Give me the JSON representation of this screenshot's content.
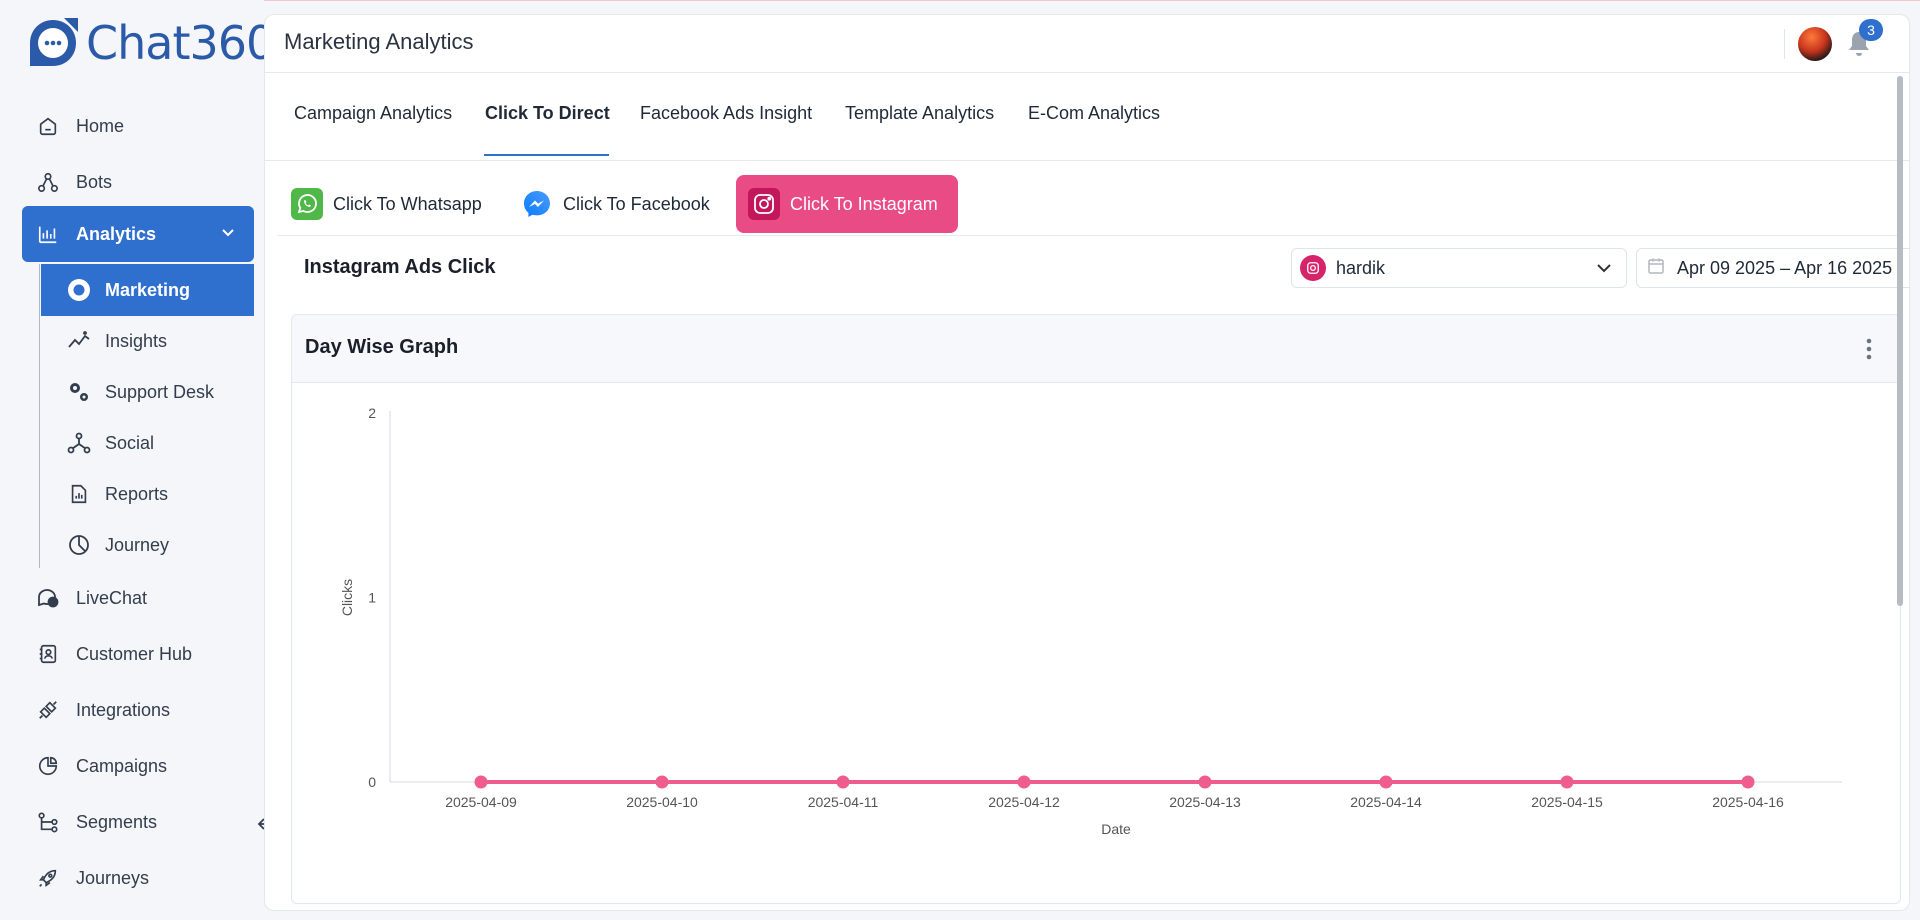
{
  "app": {
    "logo_text": "Chat360"
  },
  "sidebar": {
    "items": [
      {
        "label": "Home",
        "icon": "home-icon"
      },
      {
        "label": "Bots",
        "icon": "bots-icon"
      },
      {
        "label": "Analytics",
        "icon": "analytics-icon",
        "active": true
      },
      {
        "label": "LiveChat",
        "icon": "livechat-icon"
      },
      {
        "label": "Customer Hub",
        "icon": "customer-hub-icon"
      },
      {
        "label": "Integrations",
        "icon": "integrations-icon"
      },
      {
        "label": "Campaigns",
        "icon": "campaigns-icon"
      },
      {
        "label": "Segments",
        "icon": "segments-icon"
      },
      {
        "label": "Journeys",
        "icon": "journeys-icon"
      }
    ],
    "analytics_sub": [
      {
        "label": "Marketing",
        "icon": "marketing-icon",
        "active": true
      },
      {
        "label": "Insights",
        "icon": "insights-icon"
      },
      {
        "label": "Support Desk",
        "icon": "support-desk-icon"
      },
      {
        "label": "Social",
        "icon": "social-icon"
      },
      {
        "label": "Reports",
        "icon": "reports-icon"
      },
      {
        "label": "Journey",
        "icon": "journey-icon"
      }
    ]
  },
  "header": {
    "title": "Marketing Analytics",
    "notification_count": "3"
  },
  "tabs": [
    {
      "label": "Campaign Analytics"
    },
    {
      "label": "Click To Direct",
      "active": true
    },
    {
      "label": "Facebook Ads Insight"
    },
    {
      "label": "Template Analytics"
    },
    {
      "label": "E-Com Analytics"
    }
  ],
  "subtabs": [
    {
      "label": "Click To Whatsapp",
      "icon": "whatsapp-icon"
    },
    {
      "label": "Click To Facebook",
      "icon": "messenger-icon"
    },
    {
      "label": "Click To Instagram",
      "icon": "instagram-icon",
      "active": true
    }
  ],
  "section": {
    "title": "Instagram Ads Click",
    "account_select": "hardik",
    "date_range": "Apr 09 2025 – Apr 16 2025"
  },
  "graph": {
    "title": "Day Wise Graph"
  },
  "colors": {
    "accent": "#2f6fce",
    "instagram": "#e94c84",
    "line": "#ee5d8e"
  },
  "chart_data": {
    "type": "line",
    "x": [
      "2025-04-09",
      "2025-04-10",
      "2025-04-11",
      "2025-04-12",
      "2025-04-13",
      "2025-04-14",
      "2025-04-15",
      "2025-04-16"
    ],
    "series": [
      {
        "values": [
          0,
          0,
          0,
          0,
          0,
          0,
          0,
          0
        ]
      }
    ],
    "xlabel": "Date",
    "ylabel": "Clicks",
    "ylim": [
      0,
      2
    ],
    "yticks": [
      "0",
      "1",
      "2"
    ],
    "grid": false
  }
}
